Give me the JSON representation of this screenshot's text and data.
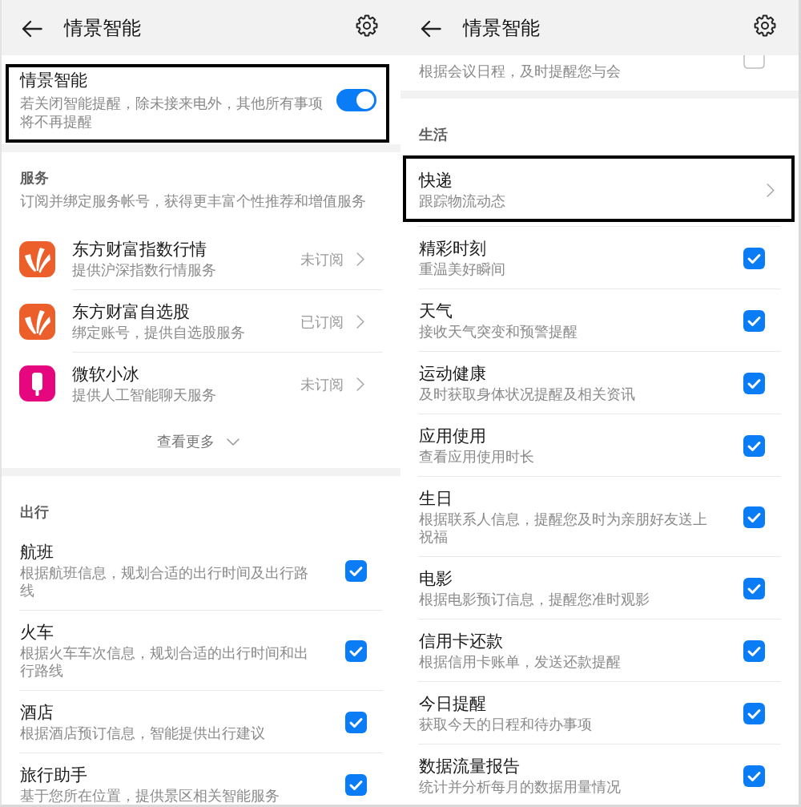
{
  "screens": [
    {
      "header": {
        "title": "情景智能"
      },
      "sections": [
        {
          "kind": "master",
          "title": "情景智能",
          "subtitle": "若关闭智能提醒，除未接来电外，其他所有事项将不再提醒",
          "on": true,
          "highlighted": true
        },
        {
          "kind": "services",
          "heading": "服务",
          "description": "订阅并绑定服务帐号，获得更丰富个性推荐和增值服务",
          "items": [
            {
              "title": "东方财富指数行情",
              "subtitle": "提供沪深指数行情服务",
              "status": "未订阅",
              "color": "#ec5f2a"
            },
            {
              "title": "东方财富自选股",
              "subtitle": "绑定账号，提供自选股服务",
              "status": "已订阅",
              "color": "#ec5f2a"
            },
            {
              "title": "微软小冰",
              "subtitle": "提供人工智能聊天服务",
              "status": "未订阅",
              "color": "#e6077f"
            }
          ],
          "more": "查看更多"
        },
        {
          "kind": "list",
          "heading": "出行",
          "items": [
            {
              "kind": "check",
              "title": "航班",
              "subtitle": "根据航班信息，规划合适的出行时间及出行路线",
              "checked": true
            },
            {
              "kind": "check",
              "title": "火车",
              "subtitle": "根据火车车次信息，规划合适的出行时间和出行路线",
              "checked": true
            },
            {
              "kind": "check",
              "title": "酒店",
              "subtitle": "根据酒店预订信息，智能提供出行建议",
              "checked": true
            },
            {
              "kind": "check",
              "title": "旅行助手",
              "subtitle": "基于您所在位置，提供景区相关智能服务",
              "checked": true
            }
          ]
        }
      ]
    },
    {
      "header": {
        "title": "情景智能"
      },
      "sections": [
        {
          "kind": "list",
          "items": [
            {
              "kind": "check",
              "subtitle": "根据会议日程，及时提醒您与会",
              "checked": false
            }
          ]
        },
        {
          "kind": "list",
          "heading": "生活",
          "items": [
            {
              "kind": "link",
              "title": "快递",
              "subtitle": "跟踪物流动态",
              "highlighted": true
            },
            {
              "kind": "check",
              "title": "精彩时刻",
              "subtitle": "重温美好瞬间",
              "checked": true
            },
            {
              "kind": "check",
              "title": "天气",
              "subtitle": "接收天气突变和预警提醒",
              "checked": true
            },
            {
              "kind": "check",
              "title": "运动健康",
              "subtitle": "及时获取身体状况提醒及相关资讯",
              "checked": true
            },
            {
              "kind": "check",
              "title": "应用使用",
              "subtitle": "查看应用使用时长",
              "checked": true
            },
            {
              "kind": "check",
              "title": "生日",
              "subtitle": "根据联系人信息，提醒您及时为亲朋好友送上祝福",
              "checked": true
            },
            {
              "kind": "check",
              "title": "电影",
              "subtitle": "根据电影预订信息，提醒您准时观影",
              "checked": true
            },
            {
              "kind": "check",
              "title": "信用卡还款",
              "subtitle": "根据信用卡账单，发送还款提醒",
              "checked": true
            },
            {
              "kind": "check",
              "title": "今日提醒",
              "subtitle": "获取今天的日程和待办事项",
              "checked": true
            },
            {
              "kind": "check",
              "title": "数据流量报告",
              "subtitle": "统计并分析每月的数据用量情况",
              "checked": true
            }
          ]
        }
      ]
    }
  ]
}
